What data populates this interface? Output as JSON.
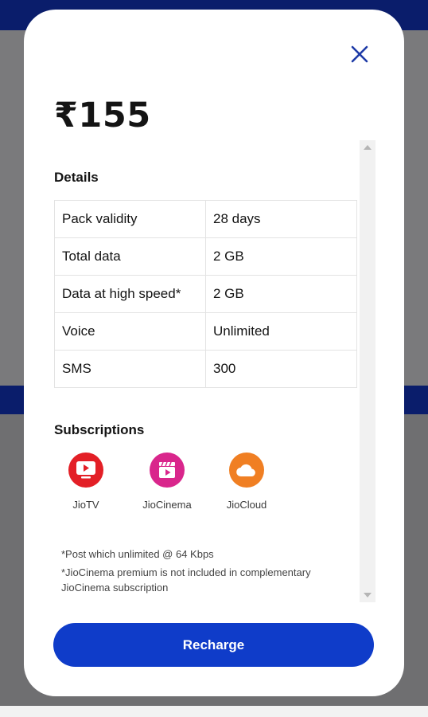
{
  "modal": {
    "price": "₹155",
    "details_title": "Details",
    "details": [
      {
        "label": "Pack validity",
        "value": "28 days"
      },
      {
        "label": "Total data",
        "value": "2 GB"
      },
      {
        "label": "Data at high speed*",
        "value": "2 GB"
      },
      {
        "label": "Voice",
        "value": "Unlimited"
      },
      {
        "label": "SMS",
        "value": "300"
      }
    ],
    "subscriptions_title": "Subscriptions",
    "subscriptions": [
      {
        "name": "JioTV",
        "icon": "tv-icon",
        "color": "#e31f26"
      },
      {
        "name": "JioCinema",
        "icon": "clapperboard-icon",
        "color": "#d9268c"
      },
      {
        "name": "JioCloud",
        "icon": "cloud-icon",
        "color": "#f07f23"
      }
    ],
    "notes": [
      "*Post which unlimited @ 64 Kbps",
      "*JioCinema premium is not included in complementary JioCinema subscription"
    ],
    "recharge_label": "Recharge"
  },
  "colors": {
    "accent": "#0f3cc9",
    "close_icon": "#1d3aa6",
    "header_band": "#0a1d6b"
  }
}
